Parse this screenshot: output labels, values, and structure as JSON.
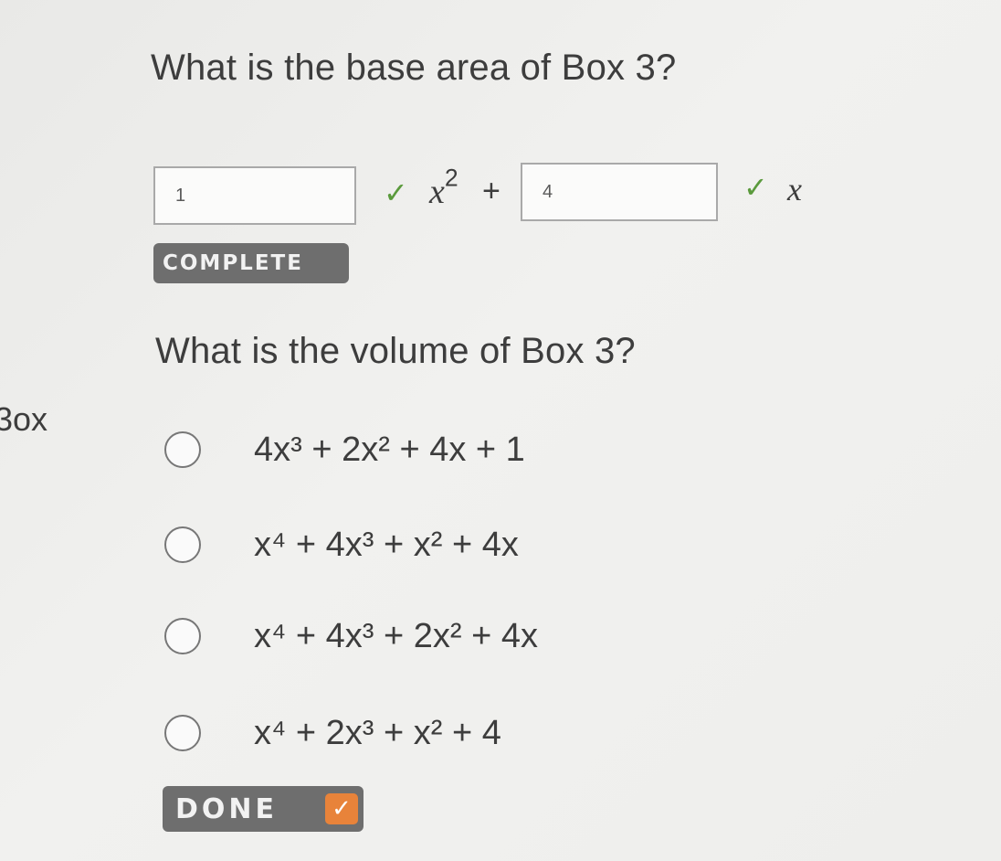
{
  "question1": {
    "title": "What is the base area of Box 3?",
    "input1_value": "1",
    "input2_value": "4",
    "term1_base": "x",
    "term1_exp": "2",
    "plus": "+",
    "term2": "x",
    "check_symbol": "✓",
    "status_label": "COMPLETE"
  },
  "question2": {
    "title": "What is the volume of Box 3?",
    "side_fragment": "3ox",
    "options": [
      {
        "label": "4x³ + 2x² + 4x + 1"
      },
      {
        "label": "x⁴ + 4x³ + x² + 4x"
      },
      {
        "label": "x⁴ + 4x³ + 2x² + 4x"
      },
      {
        "label": "x⁴ + 2x³ + x² + 4"
      }
    ],
    "done_label": "DONE",
    "done_check": "✓"
  },
  "colors": {
    "check_green": "#5a9a3c",
    "badge_gray": "#6e6e6e",
    "done_orange": "#e8833a"
  }
}
